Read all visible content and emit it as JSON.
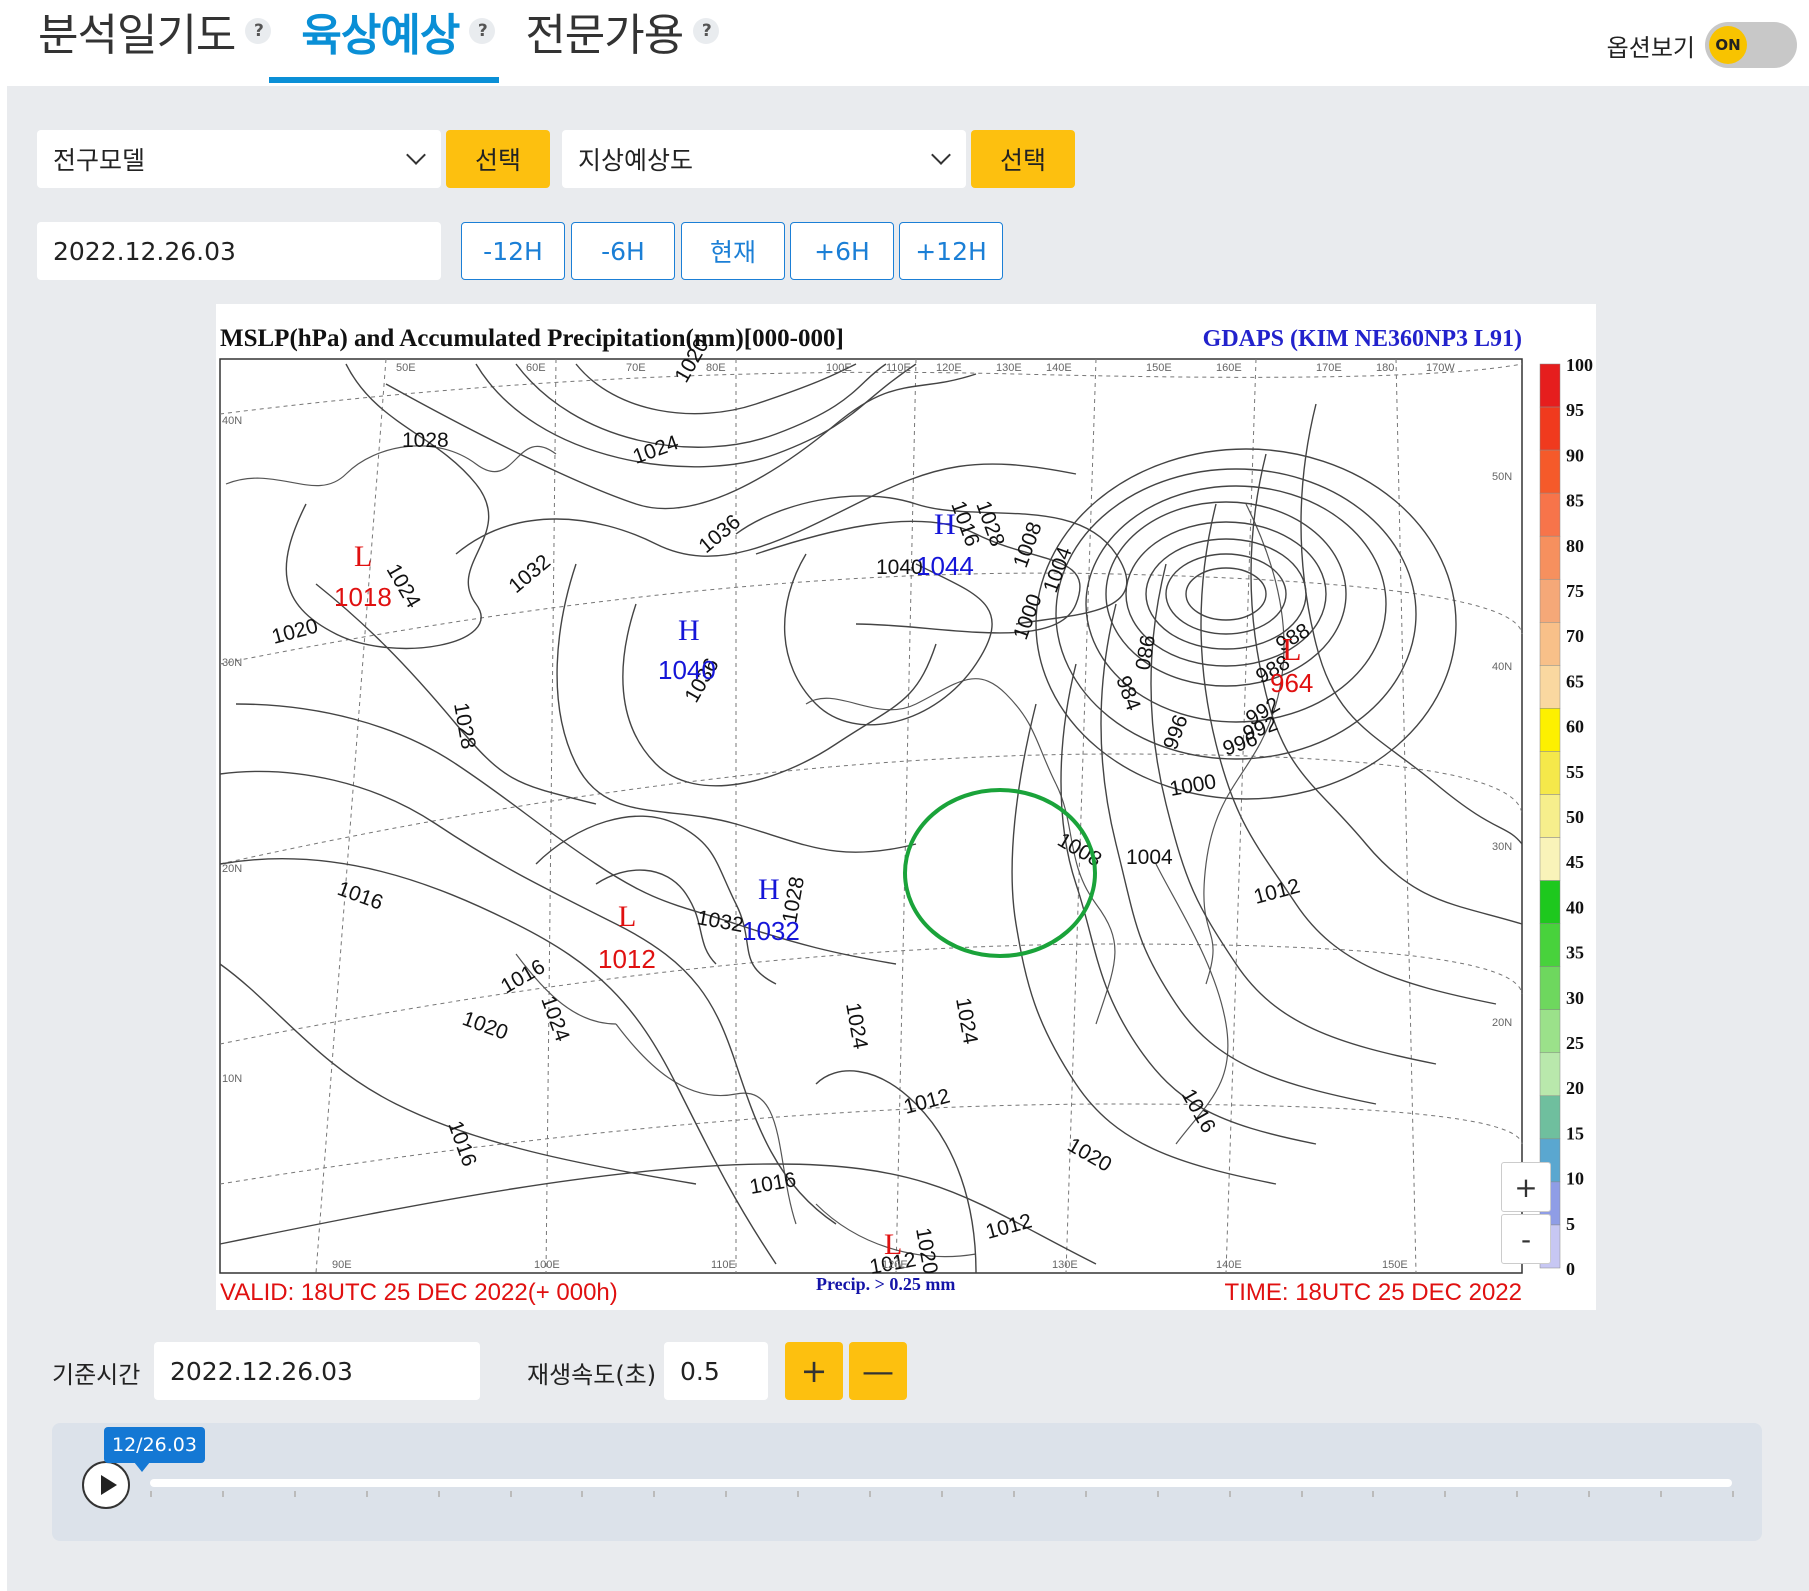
{
  "tabs": [
    {
      "label": "분석일기도",
      "help": "?"
    },
    {
      "label": "육상예상",
      "help": "?"
    },
    {
      "label": "전문가용",
      "help": "?"
    }
  ],
  "options": {
    "label": "옵션보기",
    "toggle": "ON"
  },
  "controls": {
    "model_select": "전구모델",
    "chart_select": "지상예상도",
    "select_button": "선택",
    "datetime": "2022.12.26.03",
    "time_buttons": [
      "-12H",
      "-6H",
      "현재",
      "+6H",
      "+12H"
    ]
  },
  "map": {
    "title": "MSLP(hPa) and Accumulated Precipitation(mm)[000-000]",
    "model": "GDAPS (KIM NE360NP3 L91)",
    "valid": "VALID: 18UTC 25 DEC 2022(+ 000h)",
    "time": "TIME: 18UTC 25 DEC 2022",
    "precip_note": "Precip. > 0.25 mm",
    "legend_values": [
      "100",
      "95",
      "90",
      "85",
      "80",
      "75",
      "70",
      "65",
      "60",
      "55",
      "50",
      "45",
      "40",
      "35",
      "30",
      "25",
      "20",
      "15",
      "10",
      "5",
      "0"
    ],
    "legend_colors": [
      "#e61e1e",
      "#f03a1e",
      "#f55a2a",
      "#f7744a",
      "#f6905e",
      "#f5a878",
      "#f8c089",
      "#fad8a0",
      "#fdf000",
      "#f5e84a",
      "#f6ee8c",
      "#f9f3b9",
      "#1ec81e",
      "#48d23c",
      "#6ed75e",
      "#9be18a",
      "#b9e8ac",
      "#6fbf9e",
      "#5aa7d0",
      "#8f9de6",
      "#c7c7f3"
    ],
    "highs": [
      {
        "label": "H",
        "value": "1044"
      },
      {
        "label": "H",
        "value": "1040"
      },
      {
        "label": "H",
        "value": "1032"
      }
    ],
    "lows": [
      {
        "label": "L",
        "value": "1018"
      },
      {
        "label": "L",
        "value": "1012"
      },
      {
        "label": "L",
        "value": "964"
      },
      {
        "label": "L",
        "value": ""
      }
    ],
    "isobar_labels": [
      "1028",
      "1024",
      "1020",
      "1032",
      "1036",
      "1040",
      "1036",
      "1028",
      "1024",
      "1020",
      "1016",
      "1012",
      "1008",
      "1004",
      "1000",
      "996",
      "992",
      "988",
      "980",
      "984",
      "988",
      "992",
      "996",
      "1000",
      "1004",
      "1008",
      "1012",
      "1016",
      "1020",
      "1024",
      "1028",
      "1016",
      "1012",
      "1020",
      "1024",
      "1028",
      "1032",
      "1016",
      "1020",
      "1024",
      "1016",
      "1016",
      "1012"
    ],
    "lat_labels": [
      "40N",
      "30N",
      "20N",
      "10N",
      "50N",
      "40N",
      "30N",
      "20N"
    ],
    "lon_labels": [
      "50E",
      "60E",
      "70E",
      "80E",
      "100E",
      "110E",
      "120E",
      "130E",
      "140E",
      "150E",
      "160E",
      "170E",
      "180",
      "170W",
      "90E",
      "100E",
      "110E",
      "120E",
      "130E",
      "140E",
      "150E"
    ],
    "zoom_in": "+",
    "zoom_out": "-"
  },
  "playback": {
    "base_label": "기준시간",
    "base_value": "2022.12.26.03",
    "speed_label": "재생속도(초)",
    "speed_value": "0.5",
    "plus": "+",
    "minus": "—",
    "current": "12/26.03"
  }
}
